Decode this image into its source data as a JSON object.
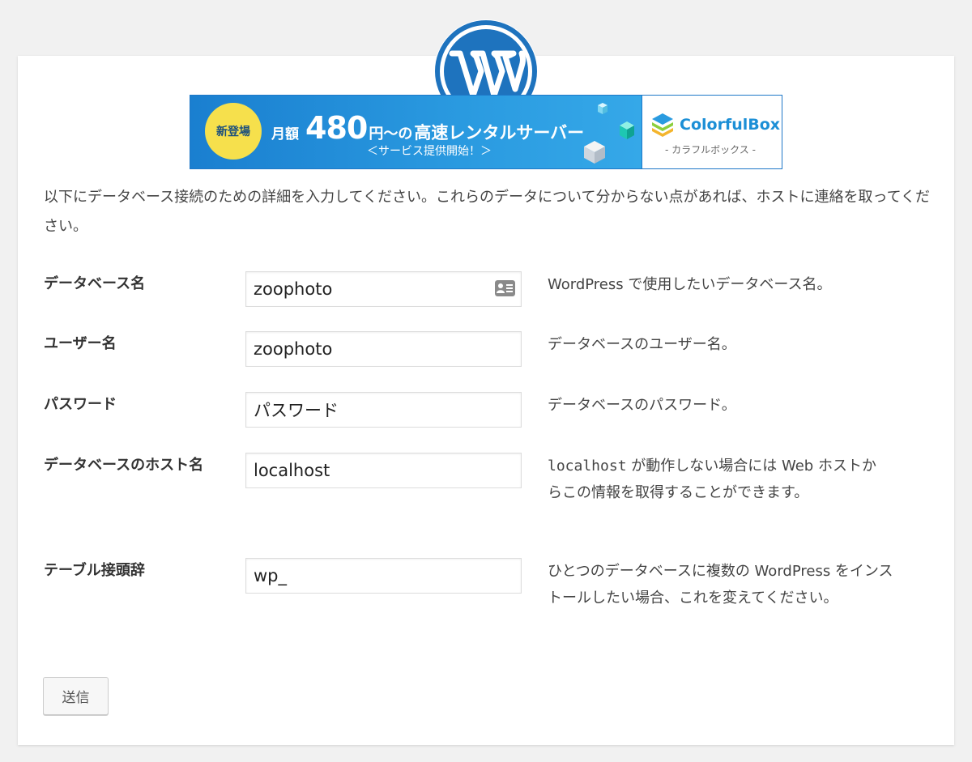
{
  "logo": {
    "icon": "wordpress-logo-icon"
  },
  "banner": {
    "badge": "新登場",
    "price_prefix": "月額",
    "price_amount": "480",
    "price_unit": "円～の",
    "price_suffix": "高速レンタルサーバー",
    "subline": "＜サービス提供開始！＞",
    "brand_name": "ColorfulBox",
    "brand_sub": "- カラフルボックス -"
  },
  "intro": "以下にデータベース接続のための詳細を入力してください。これらのデータについて分からない点があれば、ホストに連絡を取ってください。",
  "fields": [
    {
      "label": "データベース名",
      "value": "zoophoto",
      "desc": "WordPress で使用したいデータベース名。"
    },
    {
      "label": "ユーザー名",
      "value": "zoophoto",
      "desc": "データベースのユーザー名。"
    },
    {
      "label": "パスワード",
      "value": "パスワード",
      "desc": "データベースのパスワード。"
    },
    {
      "label": "データベースのホスト名",
      "value": "localhost",
      "desc_code": "localhost",
      "desc": " が動作しない場合には Web ホストからこの情報を取得することができます。"
    },
    {
      "label": "テーブル接頭辞",
      "value": "wp_",
      "desc": "ひとつのデータベースに複数の WordPress をインストールしたい場合、これを変えてください。"
    }
  ],
  "submit_label": "送信",
  "colors": {
    "background": "#f1f1f1",
    "card": "#ffffff",
    "wp_blue": "#1e73be",
    "banner_blue": "#2a9ae0",
    "badge_yellow": "#f6e04c"
  }
}
